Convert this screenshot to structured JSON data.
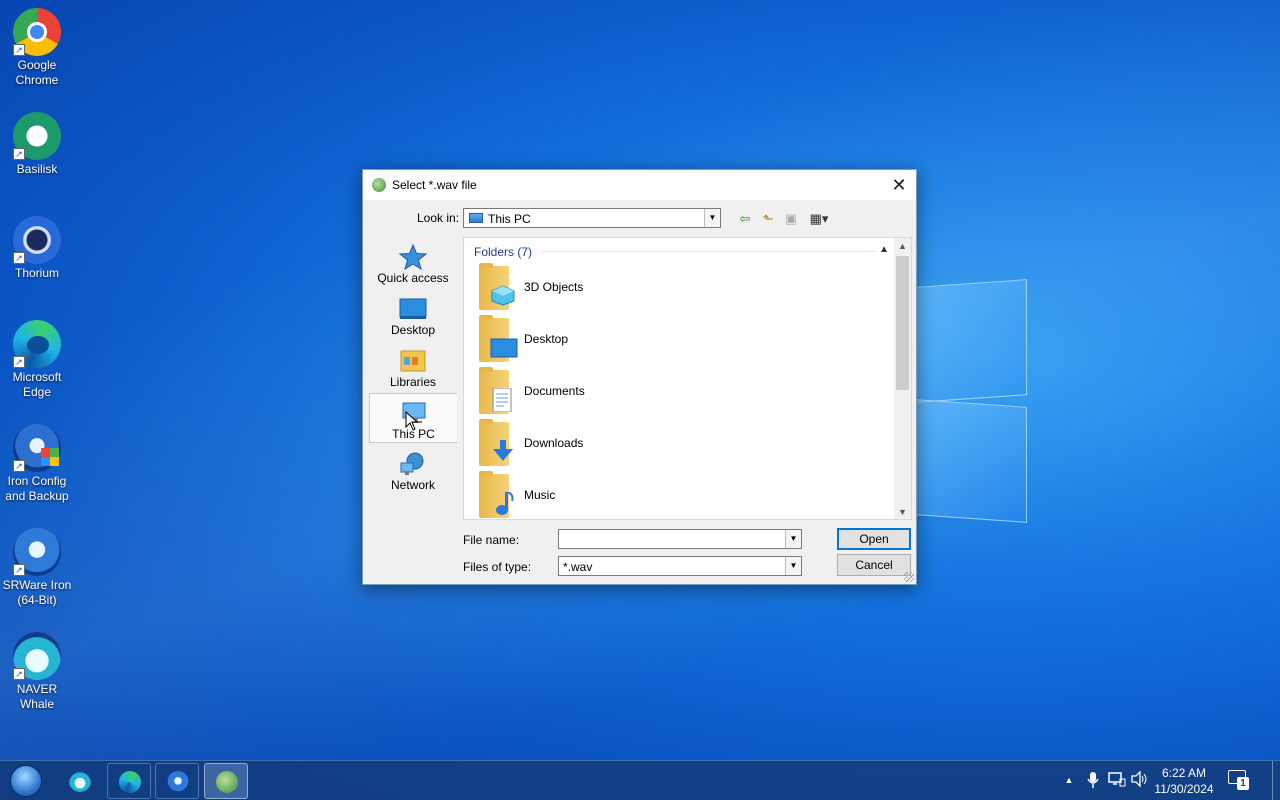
{
  "desktop": {
    "icons": [
      {
        "label_line1": "Google",
        "label_line2": "Chrome",
        "icon": "chrome-icon"
      },
      {
        "label_line1": "Basilisk",
        "label_line2": "",
        "icon": "basilisk-icon"
      },
      {
        "label_line1": "Thorium",
        "label_line2": "",
        "icon": "thorium-icon"
      },
      {
        "label_line1": "Microsoft",
        "label_line2": "Edge",
        "icon": "edge-icon"
      },
      {
        "label_line1": "Iron Config",
        "label_line2": "and Backup",
        "icon": "iron-config-icon"
      },
      {
        "label_line1": "SRWare Iron",
        "label_line2": "(64-Bit)",
        "icon": "srware-iron-icon"
      },
      {
        "label_line1": "NAVER",
        "label_line2": "Whale",
        "icon": "naver-whale-icon"
      }
    ]
  },
  "dialog": {
    "title": "Select *.wav file",
    "close_glyph": "✕",
    "look_in_label": "Look in:",
    "look_in_value": "This PC",
    "toolbar": {
      "back_glyph": "⇦",
      "up_glyph": "⬑",
      "new_folder_glyph": "▣",
      "view_menu_glyph": "▦▾"
    },
    "places": [
      {
        "label": "Quick access",
        "icon": "star-icon"
      },
      {
        "label": "Desktop",
        "icon": "desktop-icon"
      },
      {
        "label": "Libraries",
        "icon": "libraries-icon"
      },
      {
        "label": "This PC",
        "icon": "this-pc-icon",
        "selected": true
      },
      {
        "label": "Network",
        "icon": "network-icon"
      }
    ],
    "group_header": "Folders (7)",
    "folders": [
      {
        "name": "3D Objects",
        "icon": "3d-objects-icon"
      },
      {
        "name": "Desktop",
        "icon": "desktop-folder-icon"
      },
      {
        "name": "Documents",
        "icon": "documents-icon"
      },
      {
        "name": "Downloads",
        "icon": "downloads-icon"
      },
      {
        "name": "Music",
        "icon": "music-icon"
      }
    ],
    "file_name_label": "File name:",
    "file_name_value": "",
    "files_of_type_label": "Files of type:",
    "files_of_type_value": "*.wav",
    "open_label": "Open",
    "cancel_label": "Cancel"
  },
  "taskbar": {
    "apps": [
      {
        "name": "naver-whale",
        "active": false
      },
      {
        "name": "edge",
        "active": false
      },
      {
        "name": "srware-iron",
        "active": false
      },
      {
        "name": "wav-selector",
        "active": true
      }
    ],
    "tray_chevron": "▲",
    "time": "6:22 AM",
    "date": "11/30/2024",
    "notification_count": "1"
  },
  "colors": {
    "accent": "#0078d7",
    "folder_yellow": "#f5d27a",
    "group_header_blue": "#1e3f8c"
  }
}
